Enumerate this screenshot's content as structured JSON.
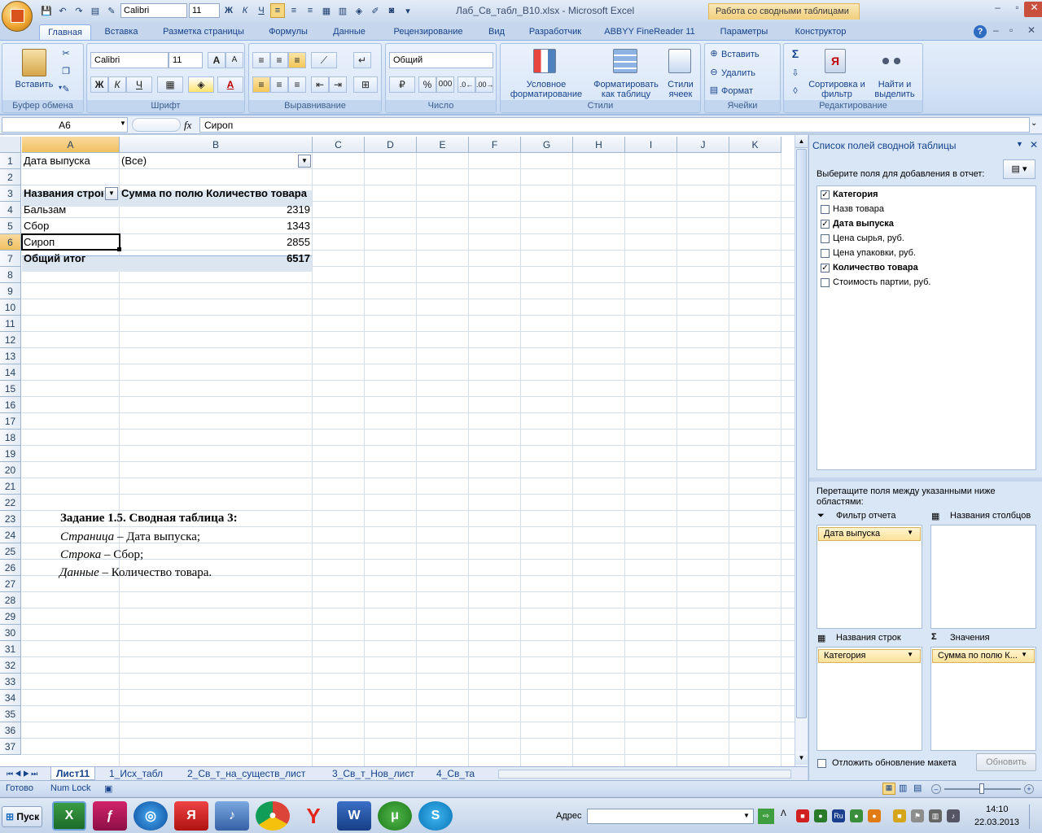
{
  "window": {
    "title": "Лаб_Св_табл_В10.xlsx - Microsoft Excel",
    "context_tab": "Работа со сводными таблицами"
  },
  "qat": {
    "font": "Calibri",
    "size": "11",
    "bold": "Ж",
    "italic": "К",
    "underline": "Ч"
  },
  "tabs": [
    "Главная",
    "Вставка",
    "Разметка страницы",
    "Формулы",
    "Данные",
    "Рецензирование",
    "Вид",
    "Разработчик",
    "ABBYY FineReader 11",
    "Параметры",
    "Конструктор"
  ],
  "ribbon": {
    "clipboard": {
      "label": "Буфер обмена",
      "paste": "Вставить"
    },
    "font": {
      "label": "Шрифт",
      "name": "Calibri",
      "size": "11",
      "bold": "Ж",
      "italic": "К",
      "underline": "Ч",
      "grow": "A",
      "shrink": "A",
      "color_letter": "A"
    },
    "align": {
      "label": "Выравнивание"
    },
    "number": {
      "label": "Число",
      "format": "Общий",
      "percent": "%",
      "thousands": "000"
    },
    "styles": {
      "label": "Стили",
      "cond": "Условное форматирование",
      "astable": "Форматировать как таблицу",
      "cellstyles": "Стили ячеек"
    },
    "cells": {
      "label": "Ячейки",
      "insert": "Вставить",
      "delete": "Удалить",
      "format": "Формат"
    },
    "editing": {
      "label": "Редактирование",
      "sigma": "Σ",
      "sort": "Сортировка и фильтр",
      "find": "Найти и выделить"
    }
  },
  "formula": {
    "namebox": "A6",
    "fx": "fx",
    "value": "Сироп"
  },
  "grid": {
    "columns": [
      "A",
      "B",
      "C",
      "D",
      "E",
      "F",
      "G",
      "H",
      "I",
      "J",
      "K"
    ],
    "rows": [
      "1",
      "2",
      "3",
      "4",
      "5",
      "6",
      "7",
      "8",
      "9",
      "10",
      "11",
      "12",
      "13",
      "14",
      "15",
      "16",
      "17",
      "18",
      "19",
      "20",
      "21",
      "22",
      "23",
      "24",
      "25",
      "26",
      "27",
      "28",
      "29",
      "30",
      "31",
      "32",
      "33",
      "34",
      "35",
      "36",
      "37"
    ],
    "filter_label": "Дата выпуска",
    "filter_value": "(Все)",
    "row_header": "Названия строк",
    "value_header": "Сумма по полю Количество товара",
    "items": [
      {
        "name": "Бальзам",
        "value": "2319"
      },
      {
        "name": "Сбор",
        "value": "1343"
      },
      {
        "name": "Сироп",
        "value": "2855"
      }
    ],
    "total_label": "Общий итог",
    "total_value": "6517",
    "note": {
      "title": "Задание 1.5. Сводная таблица 3:",
      "l1a": "Страница",
      "l1b": " – Дата выпуска;",
      "l2a": "Строка",
      "l2b": " – Сбор;",
      "l3a": "Данные",
      "l3b": " – Количество товара."
    }
  },
  "sheets": [
    "Лист11",
    "1_Исх_табл",
    "2_Св_т_на_существ_лист",
    "3_Св_т_Нов_лист",
    "4_Св_та"
  ],
  "pane": {
    "title": "Список полей сводной таблицы",
    "prompt": "Выберите поля для добавления в отчет:",
    "fields": [
      {
        "name": "Категория",
        "checked": true
      },
      {
        "name": "Назв товара",
        "checked": false
      },
      {
        "name": "Дата выпуска",
        "checked": true
      },
      {
        "name": "Цена сырья, руб.",
        "checked": false
      },
      {
        "name": "Цена упаковки, руб.",
        "checked": false
      },
      {
        "name": "Количество товара",
        "checked": true
      },
      {
        "name": "Стоимость партии, руб.",
        "checked": false
      }
    ],
    "drag_hint": "Перетащите поля между указанными ниже областями:",
    "report_filter": "Фильтр отчета",
    "columns_area": "Названия столбцов",
    "rows_area": "Названия строк",
    "values_area": "Значения",
    "filter_field": "Дата выпуска",
    "row_field": "Категория",
    "value_field": "Сумма по полю К...",
    "defer": "Отложить обновление макета",
    "update": "Обновить"
  },
  "status": {
    "ready": "Готово",
    "numlock": "Num Lock",
    "zoom": "100%"
  },
  "taskbar": {
    "start": "Пуск",
    "address": "Адрес",
    "lang": "Ru",
    "time": "14:10",
    "date": "22.03.2013"
  }
}
